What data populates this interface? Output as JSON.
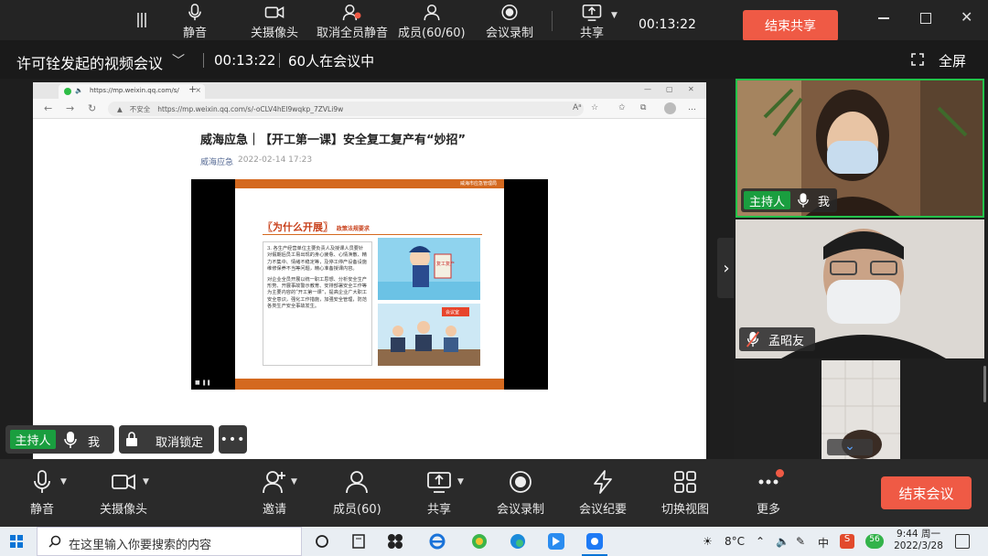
{
  "share_toolbar": {
    "buttons": [
      {
        "label": "静音",
        "icon": "mic-icon"
      },
      {
        "label": "关摄像头",
        "icon": "camera-icon"
      },
      {
        "label": "取消全员静音",
        "icon": "unmute-all-icon"
      },
      {
        "label": "成员(60/60)",
        "icon": "members-icon"
      },
      {
        "label": "会议录制",
        "icon": "record-icon"
      },
      {
        "label": "共享",
        "icon": "share-screen-icon"
      }
    ],
    "timer": "00:13:22",
    "end_share_label": "结束共享"
  },
  "meeting_bar": {
    "title": "许可铨发起的视频会议",
    "duration": "00:13:22",
    "participant_count": "60人在会议中",
    "fullscreen_label": "全屏"
  },
  "browser": {
    "tab_title": "https://mp.weixin.qq.com/s/",
    "insecure_label": "不安全",
    "url": "https://mp.weixin.qq.com/s/-oCLV4hEl9wqkp_7ZVLi9w"
  },
  "article": {
    "title": "威海应急｜【开工第一课】安全复工复产有“妙招”",
    "author": "威海应急",
    "date": "2022-02-14 17:23",
    "slide": {
      "header_org": "威海市应急管理局",
      "heading": "〖为什么开展〗",
      "subheading": "政策法规要求",
      "paragraph1": "3. 各生产经营单位主要负责人及授课人员要针对假期后员工易出现的身心疲惫、心情涣散、精力不集中、情绪不稳定等，及停工停产设备设施维修保养不当等问题，精心准备授课内容。",
      "paragraph2": "对企业全员开展以统一职工思想、分析安全生产形势、开展事故警示教育、安排部署安全工作等为主要内容的“开工第一课”，提高企业广大职工安全意识，强化工作措施，加强安全管理，防范各类生产安全事故发生。",
      "image1_sign": "复工复产",
      "image2_sign": "会议室"
    }
  },
  "overlay": {
    "host_badge": "主持人",
    "me_label": "我",
    "unlock_label": "取消锁定",
    "more_label": "•••"
  },
  "participants": [
    {
      "name": "我",
      "role": "主持人",
      "muted": false
    },
    {
      "name": "孟昭友",
      "muted": true
    },
    {
      "name": "",
      "muted": false
    }
  ],
  "meeting_toolbar": {
    "buttons": [
      {
        "label": "静音",
        "icon": "mic-icon"
      },
      {
        "label": "关摄像头",
        "icon": "camera-icon"
      },
      {
        "label": "邀请",
        "icon": "invite-icon"
      },
      {
        "label": "成员(60)",
        "icon": "members-icon"
      },
      {
        "label": "共享",
        "icon": "share-screen-icon"
      },
      {
        "label": "会议录制",
        "icon": "record-icon"
      },
      {
        "label": "会议纪要",
        "icon": "minutes-icon"
      },
      {
        "label": "切换视图",
        "icon": "grid-view-icon"
      },
      {
        "label": "更多",
        "icon": "more-icon"
      }
    ],
    "end_meeting_label": "结束会议"
  },
  "taskbar": {
    "search_placeholder": "在这里输入你要搜索的内容",
    "temperature": "8°C",
    "time": "9:44 周一",
    "date": "2022/3/28",
    "ime_label": "中",
    "badge_count": "56"
  },
  "colors": {
    "accent_red": "#ef5a45",
    "host_green": "#1a9e3f",
    "speaker_border": "#22c24a",
    "toolbar_bg": "#2a2a2a"
  }
}
